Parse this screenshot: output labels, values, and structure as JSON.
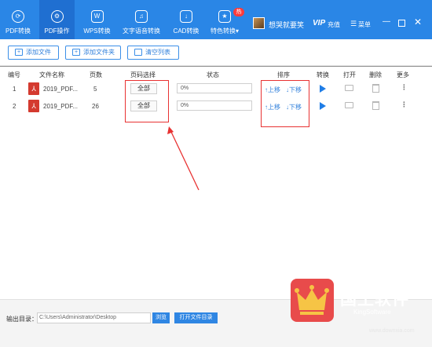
{
  "nav": {
    "items": [
      {
        "label": "PDF转换",
        "icon": "refresh-icon"
      },
      {
        "label": "PDF操作",
        "icon": "settings-icon"
      },
      {
        "label": "WPS转换",
        "icon": "wps-icon"
      },
      {
        "label": "文字语音转换",
        "icon": "audio-icon"
      },
      {
        "label": "CAD转换",
        "icon": "cad-icon"
      },
      {
        "label": "特色转换",
        "icon": "star-icon",
        "badge": "热"
      }
    ],
    "active": "PDF操作",
    "username": "想哭就要笑",
    "vip": "VIP",
    "recharge": "充值",
    "menu": "菜单"
  },
  "toolbar": {
    "add_file": "添加文件",
    "add_folder": "添加文件夹",
    "clear_list": "清空列表"
  },
  "table": {
    "headers": [
      "编号",
      "文件名称",
      "页数",
      "页码选择",
      "状态",
      "排序",
      "转换",
      "打开",
      "删除",
      "更多"
    ],
    "rows": [
      {
        "index": "1",
        "name": "2019_PDF...",
        "pages": "5",
        "range": "全部",
        "status": "0%",
        "up": "↑上移",
        "down": "↓下移"
      },
      {
        "index": "2",
        "name": "2019_PDF...",
        "pages": "26",
        "range": "全部",
        "status": "0%",
        "up": "↑上移",
        "down": "↓下移"
      }
    ]
  },
  "bottom": {
    "output_label": "输出目录：",
    "output_path": "C:\\Users\\Administrator\\Desktop",
    "browse": "浏览",
    "open_dir": "打开文件目录"
  },
  "watermark": {
    "title": "国王软件",
    "subtitle": "KingSoftware",
    "site": "www.downxia.com"
  },
  "colors": {
    "brand": "#2a86e6",
    "annotation": "#e83232",
    "pdf": "#d43a2f"
  }
}
